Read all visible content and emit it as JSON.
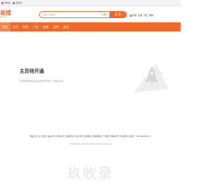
{
  "topbar": {
    "items": [
      {
        "icon": "phone-icon",
        "label": "手机版"
      },
      {
        "icon": "qrcode-icon",
        "label": "掌商城"
      }
    ]
  },
  "logo": {
    "main": "易搜",
    "sub": "eso.com"
  },
  "search": {
    "placeholder": "请输入关键词",
    "scope": "公司",
    "button": "搜 索"
  },
  "header_links": [
    {
      "icon": "user-icon",
      "label": "登录"
    },
    {
      "icon": "register-icon",
      "label": "注册"
    },
    {
      "icon": "shop-icon",
      "label": "开店"
    },
    {
      "icon": "help-icon",
      "label": "帮助"
    }
  ],
  "nav": [
    {
      "label": "首页",
      "active": true
    },
    {
      "label": "公司",
      "active": false
    },
    {
      "label": "新闻",
      "active": false
    },
    {
      "label": "产品",
      "active": false
    },
    {
      "label": "相册",
      "active": false
    },
    {
      "label": "品牌",
      "active": false
    },
    {
      "label": "留言",
      "active": false
    }
  ],
  "notice": {
    "title": "主页待开通",
    "subtitle": "您搜索的网站正在建设或暂未开通，请稍后访问"
  },
  "footer": {
    "links": [
      "网站首页",
      "关于我们",
      "联系方式",
      "使用协议",
      "版权隐私",
      "免责声明",
      "友情链接",
      "网站地图",
      "广告服务",
      "网站首页",
      "投诉举报",
      "备案号：B2-20000000-5"
    ],
    "copyright": "©2006-2024 SUSOCO.COM All Rights Reserved"
  },
  "watermark": "玖收录",
  "colors": {
    "accent": "#ef6a2a"
  }
}
